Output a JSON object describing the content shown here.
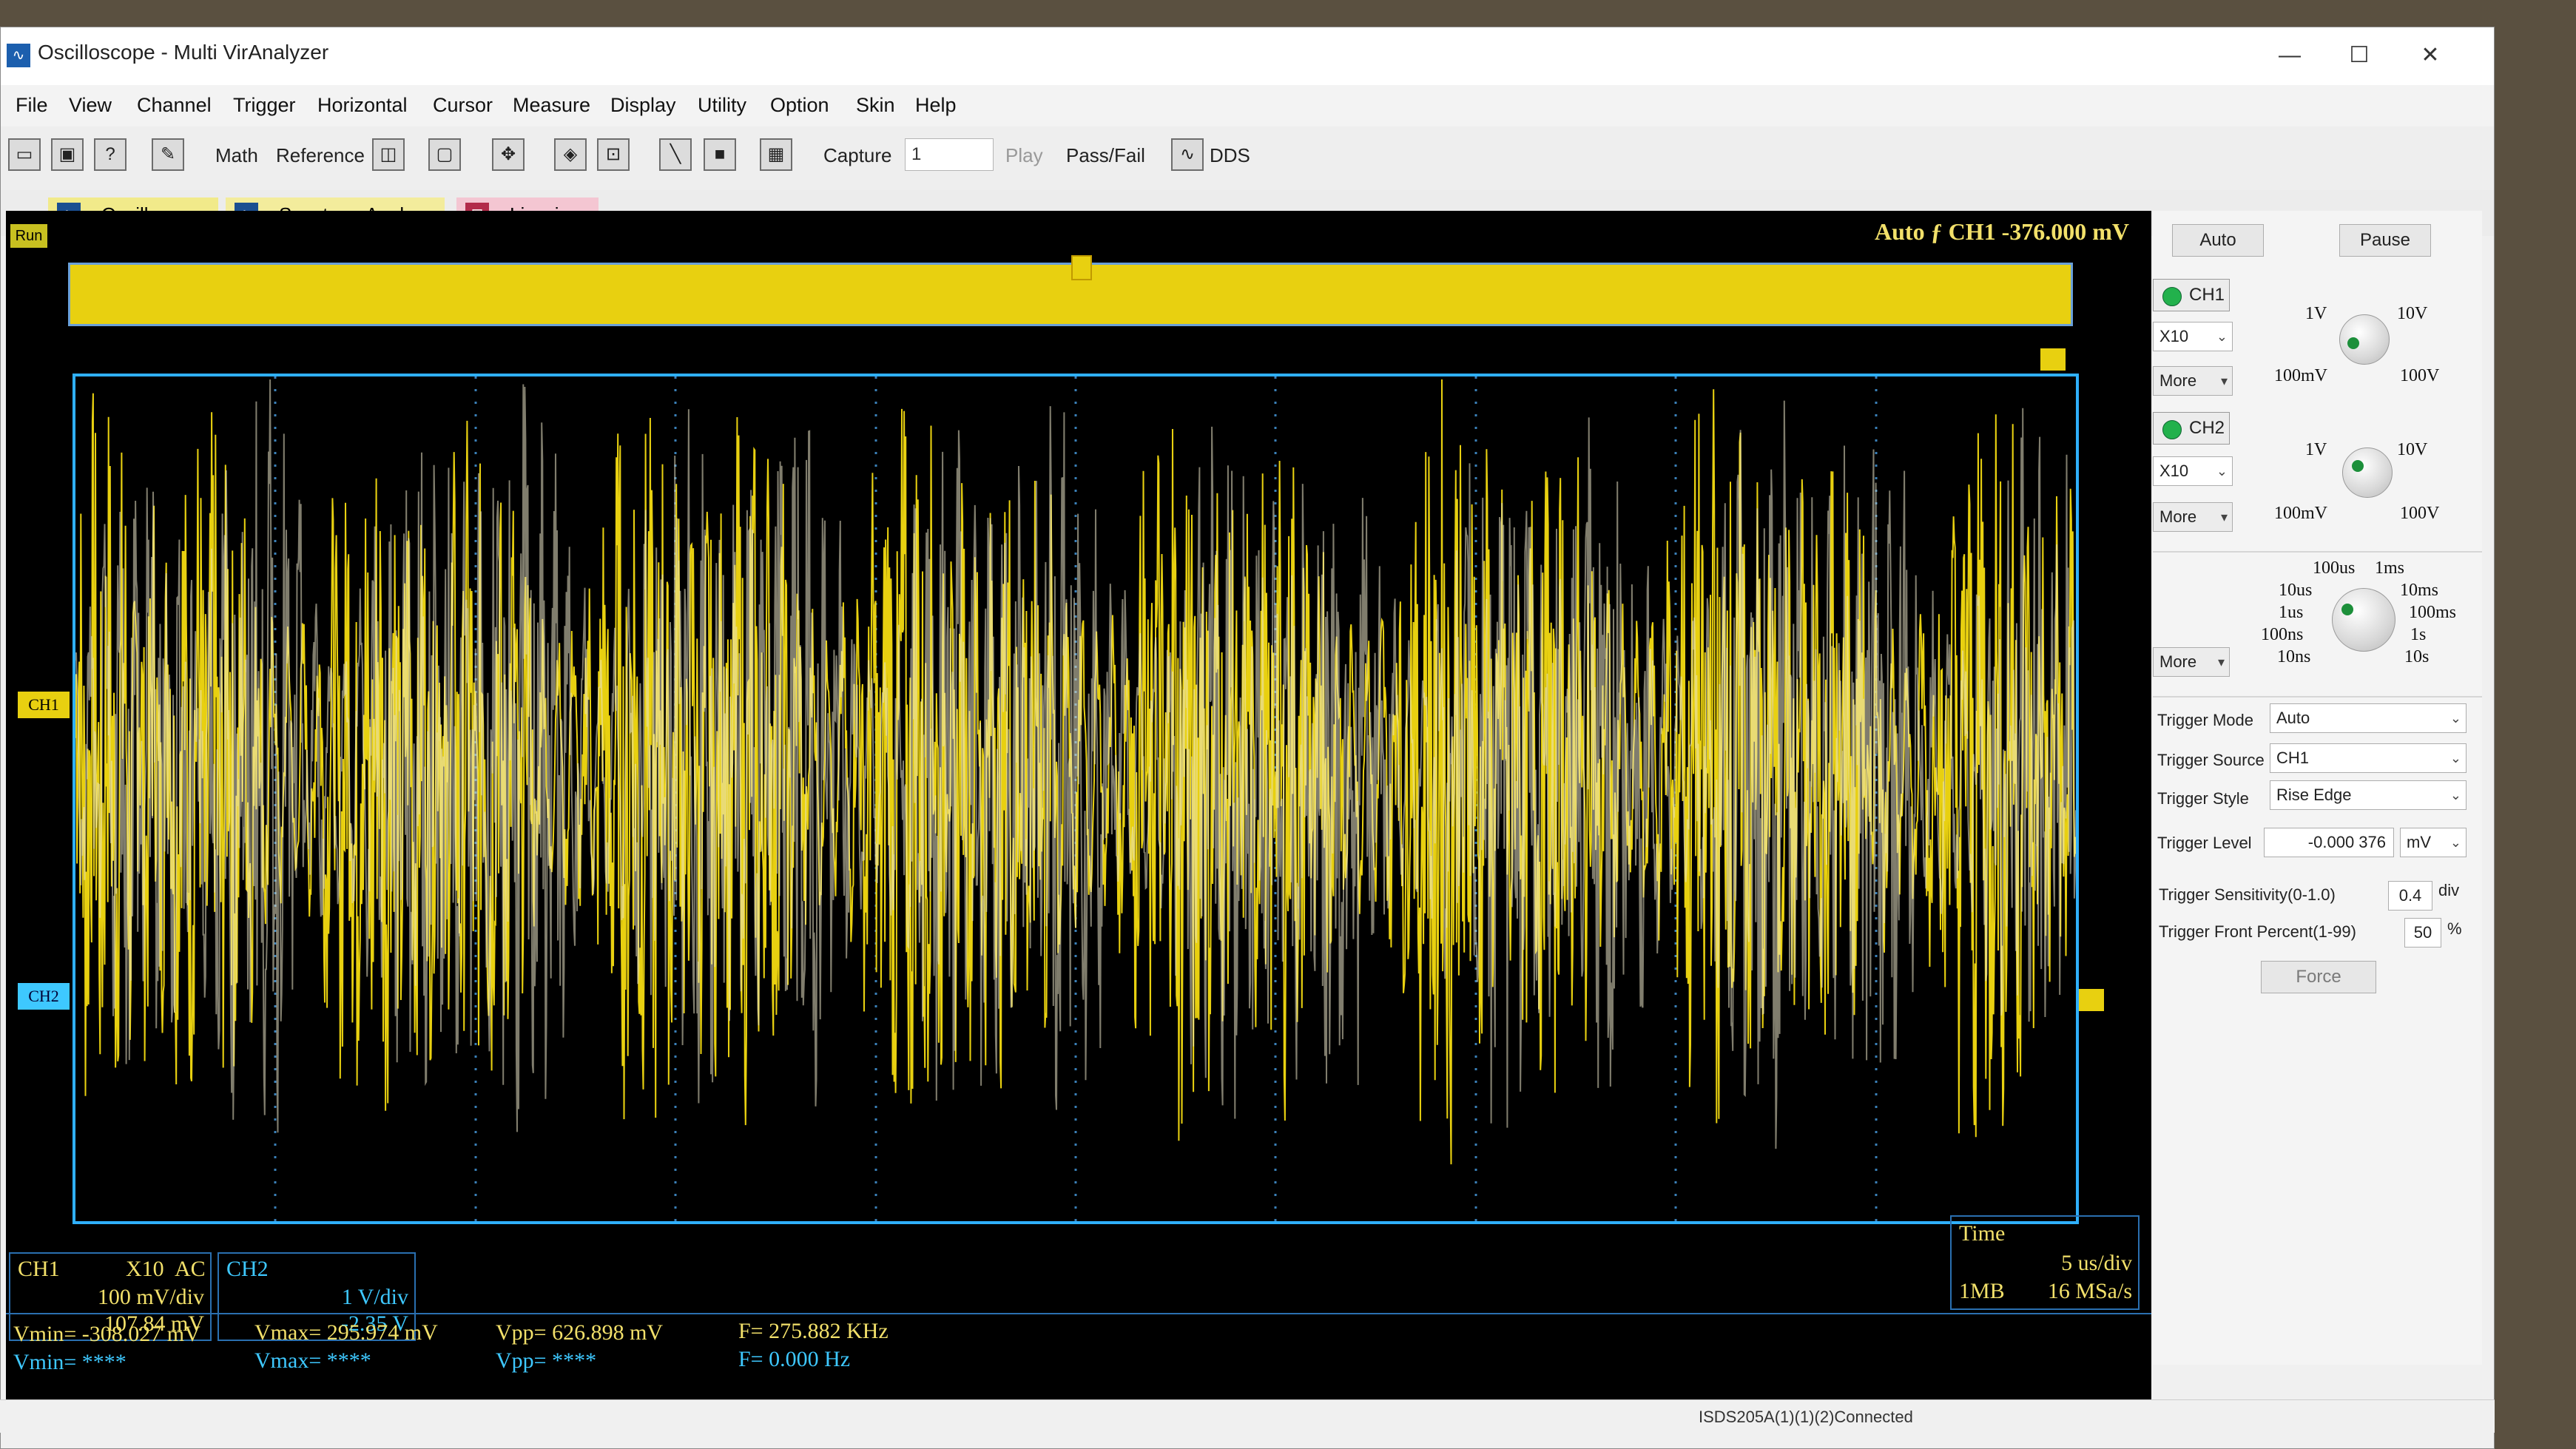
{
  "window": {
    "title": "Oscilloscope - Multi VirAnalyzer",
    "min_glyph": "—",
    "max_glyph": "☐",
    "close_glyph": "✕"
  },
  "menu": [
    "File",
    "View",
    "Channel",
    "Trigger",
    "Horizontal",
    "Cursor",
    "Measure",
    "Display",
    "Utility",
    "Option",
    "Skin",
    "Help"
  ],
  "toolbar": {
    "math": "Math",
    "reference": "Reference",
    "capture": "Capture",
    "capture_value": "1",
    "play": "Play",
    "pass_fail": "Pass/Fail",
    "dds": "DDS"
  },
  "tabs": [
    "Oscilloscope",
    "Spectrum Analyzer",
    "Lissajous"
  ],
  "scope": {
    "run_badge": "Run",
    "trigger_status": "Auto  ƒ  CH1  -376.000 mV",
    "ch1_marker": "CH1",
    "ch2_marker": "CH2",
    "colors": {
      "ch1": "#e8d010",
      "ch2": "#3ec8ff",
      "frame": "#2fb0ff"
    }
  },
  "ch1_box": {
    "name": "CH1",
    "probe": "X10",
    "coupling": "AC",
    "scale": "100 mV/div",
    "offset": "107.84 mV"
  },
  "ch2_box": {
    "name": "CH2",
    "scale": "1 V/div",
    "offset": "-2.35 V"
  },
  "time_box": {
    "label": "Time",
    "timebase": "5 us/div",
    "depth": "1MB",
    "rate": "16 MSa/s"
  },
  "measurements": {
    "ch1_vmin": "Vmin= -308.027 mV",
    "ch1_vmax": "Vmax= 295.974 mV",
    "ch1_vpp": "Vpp= 626.898 mV",
    "ch1_freq": "F= 275.882 KHz",
    "ch2_vmin": "Vmin= ****",
    "ch2_vmax": "Vmax= ****",
    "ch2_vpp": "Vpp= ****",
    "ch2_freq": "F= 0.000 Hz"
  },
  "panel": {
    "auto": "Auto",
    "pause": "Pause",
    "ch1": {
      "label": "CH1",
      "probe": "X10",
      "more": "More"
    },
    "ch2": {
      "label": "CH2",
      "probe": "X10",
      "more": "More"
    },
    "volt_knob": {
      "top_left": "1V",
      "top_right": "10V",
      "bottom_left": "100mV",
      "bottom_right": "100V"
    },
    "time_more": "More",
    "time_knob": {
      "l1": "100us",
      "l2": "1ms",
      "l3": "10us",
      "l4": "10ms",
      "l5": "1us",
      "l6": "100ms",
      "l7": "100ns",
      "l8": "1s",
      "l9": "10ns",
      "l10": "10s"
    },
    "trigger_mode_label": "Trigger Mode",
    "trigger_mode": "Auto",
    "trigger_source_label": "Trigger Source",
    "trigger_source": "CH1",
    "trigger_style_label": "Trigger Style",
    "trigger_style": "Rise Edge",
    "trigger_level_label": "Trigger Level",
    "trigger_level": "-0.000 376",
    "trigger_level_unit": "mV",
    "sensitivity_label": "Trigger Sensitivity(0-1.0)",
    "sensitivity": "0.4",
    "sensitivity_unit": "div",
    "front_label": "Trigger Front Percent(1-99)",
    "front": "50",
    "front_unit": "%",
    "force": "Force"
  },
  "status": "ISDS205A(1)(1)(2)Connected"
}
